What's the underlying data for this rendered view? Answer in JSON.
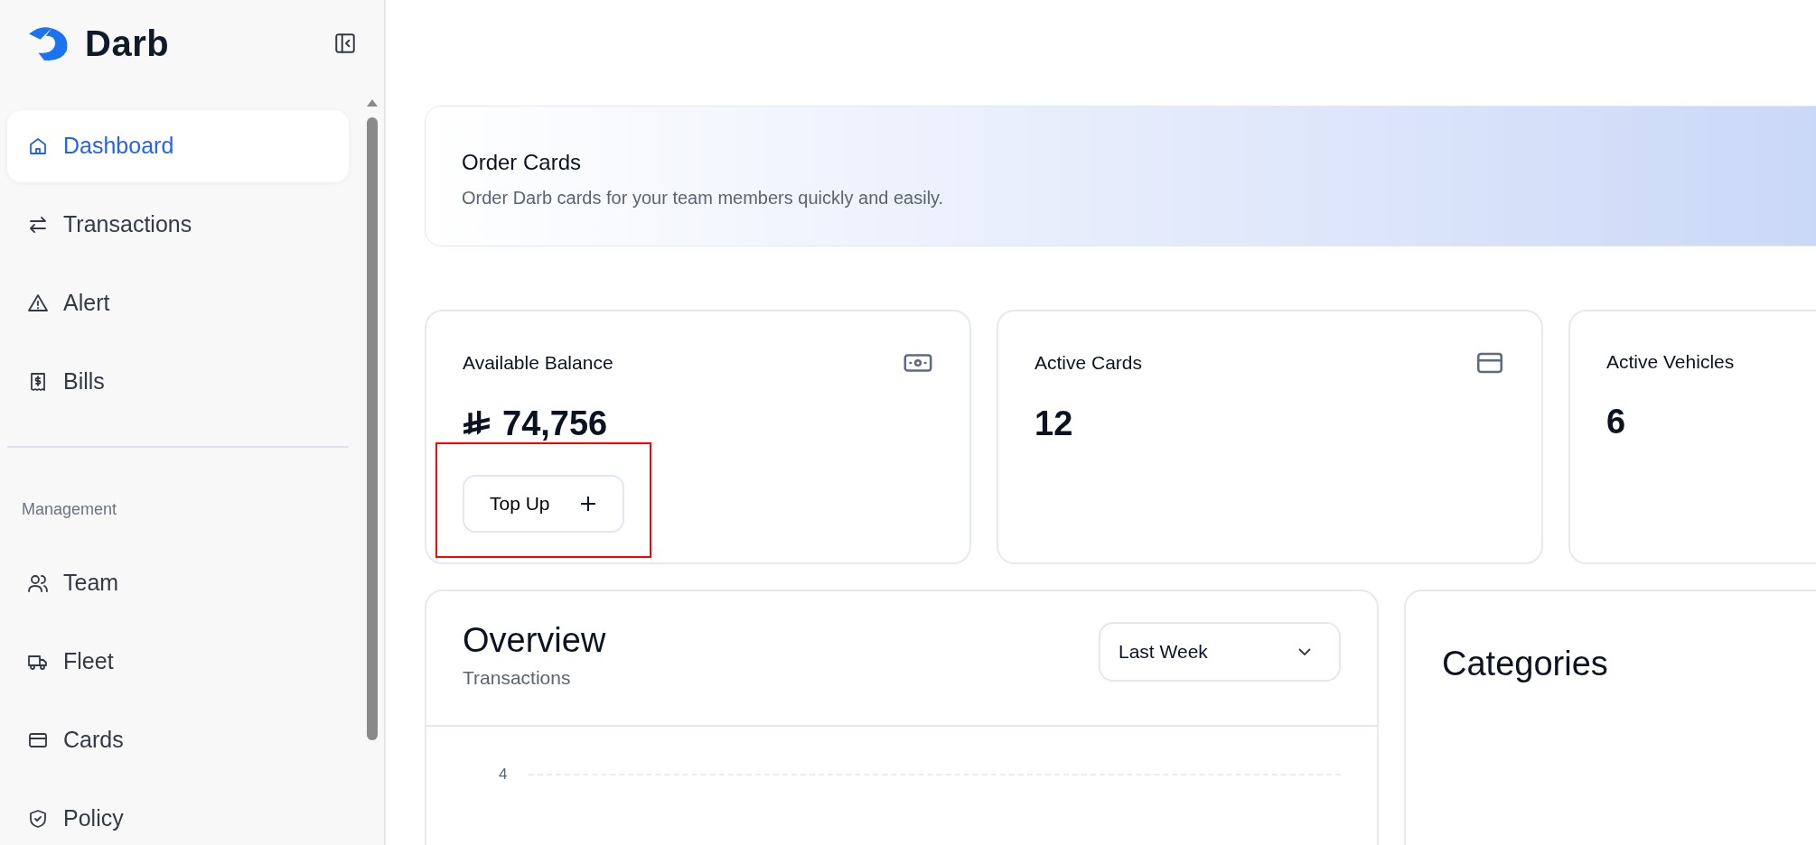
{
  "sidebar": {
    "logo_text": "Darb",
    "items": [
      {
        "label": "Dashboard",
        "kind": "home",
        "selected": true
      },
      {
        "label": "Transactions",
        "kind": "arrows",
        "selected": false
      },
      {
        "label": "Alert",
        "kind": "warning",
        "selected": false
      },
      {
        "label": "Bills",
        "kind": "bill",
        "selected": false
      }
    ],
    "section_title": "Management",
    "management_items": [
      {
        "label": "Team",
        "kind": "users",
        "selected": false
      },
      {
        "label": "Fleet",
        "kind": "truck",
        "selected": false
      },
      {
        "label": "Cards",
        "kind": "card",
        "selected": false
      },
      {
        "label": "Policy",
        "kind": "shield",
        "selected": false
      }
    ]
  },
  "banner": {
    "title": "Order Cards",
    "subtitle": "Order Darb cards for your team members quickly and easily."
  },
  "stats": [
    {
      "label": "Available Balance",
      "value": "74,756",
      "currency": true,
      "kind": "cash",
      "button": {
        "label": "Top Up",
        "highlighted": true
      }
    },
    {
      "label": "Active Cards",
      "value": "12",
      "currency": false,
      "kind": "card"
    },
    {
      "label": "Active Vehicles",
      "value": "6",
      "currency": false,
      "kind": "plain"
    }
  ],
  "overview": {
    "title": "Overview",
    "subtitle": "Transactions",
    "period": "Last Week",
    "y_tick_labels": [
      "4"
    ]
  },
  "categories": {
    "title": "Categories"
  }
}
